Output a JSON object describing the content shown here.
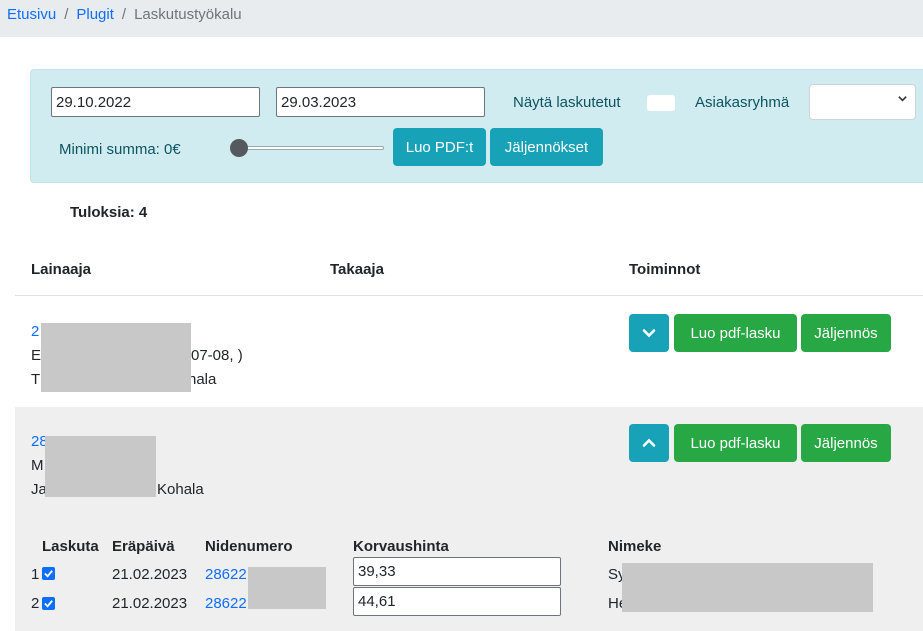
{
  "breadcrumb": {
    "items": [
      {
        "label": "Etusivu"
      },
      {
        "label": "Plugit"
      },
      {
        "label": "Laskutustyökalu"
      }
    ]
  },
  "filter": {
    "start_date": "29.10.2022",
    "end_date": "29.03.2023",
    "show_invoiced_label": "Näytä laskutetut",
    "show_invoiced": false,
    "customer_group_label": "Asiakasryhmä",
    "customer_group_value": "",
    "min_sum_label": "Minimi summa: 0€",
    "min_sum_value": 0,
    "create_pdfs_label": "Luo PDF:t",
    "copies_label": "Jäljennökset"
  },
  "results_label": "Tuloksia: 4",
  "table": {
    "headers": {
      "borrower": "Lainaaja",
      "guarantor": "Takaaja",
      "actions": "Toiminnot"
    },
    "rows": [
      {
        "id_prefix": "2",
        "line2_prefix": "E",
        "line2_suffix": "07-08, )",
        "line3_prefix": "T",
        "line3_suffix": "hala",
        "expanded": false,
        "create_pdf_label": "Luo pdf-lasku",
        "copy_label": "Jäljennös"
      },
      {
        "id_prefix": "28",
        "line2_prefix": "M",
        "line3_prefix": "Ja",
        "line3_suffix": "Kohala",
        "expanded": true,
        "create_pdf_label": "Luo pdf-lasku",
        "copy_label": "Jäljennös"
      }
    ]
  },
  "items": {
    "headers": {
      "invoice": "Laskuta",
      "due_date": "Eräpäivä",
      "item_number": "Nidenumero",
      "price": "Korvaushinta",
      "title": "Nimeke"
    },
    "rows": [
      {
        "index": "1",
        "checked": true,
        "due_date": "21.02.2023",
        "item_number": "28622",
        "price": "39,33",
        "title_prefix": "Sy"
      },
      {
        "index": "2",
        "checked": true,
        "due_date": "21.02.2023",
        "item_number": "28622",
        "price": "44,61",
        "title_prefix": "He"
      }
    ]
  },
  "colors": {
    "link": "#0d6efd",
    "info": "#17a2b8",
    "success": "#28a745",
    "panel": "#d1ecf1"
  }
}
